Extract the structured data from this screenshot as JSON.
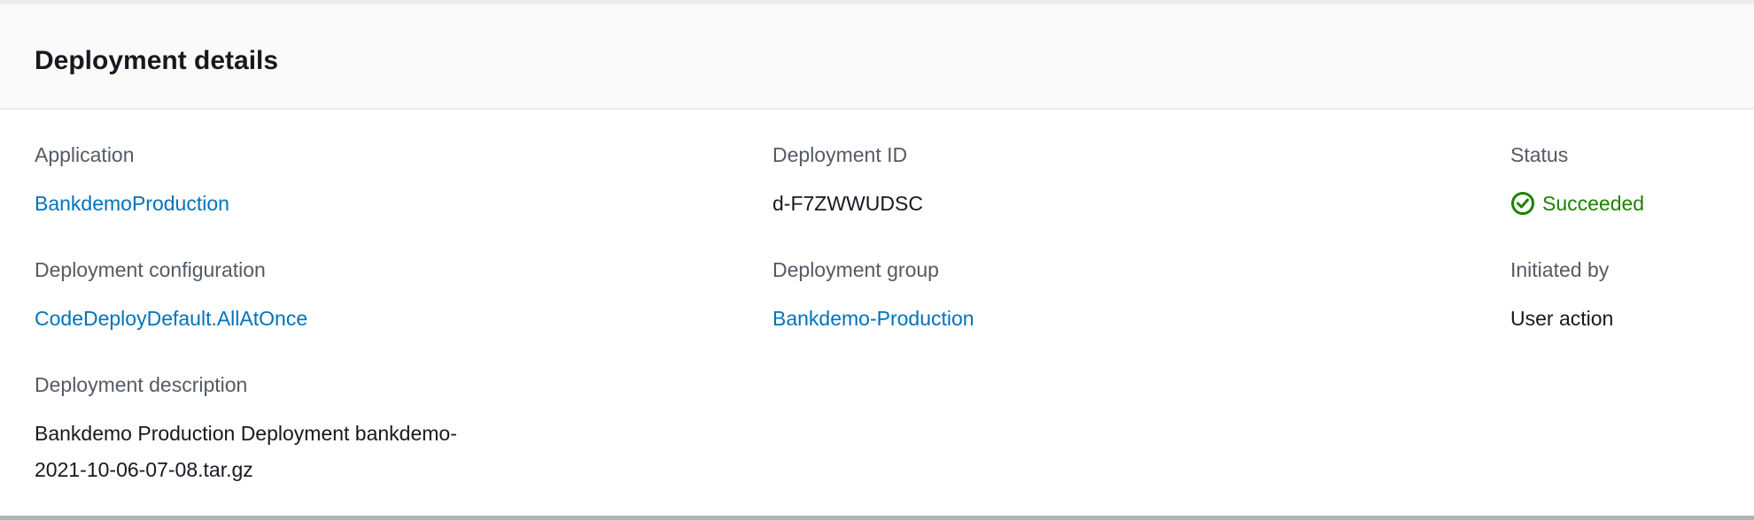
{
  "header": {
    "title": "Deployment details"
  },
  "fields": {
    "application": {
      "label": "Application",
      "value": "BankdemoProduction"
    },
    "deployment_id": {
      "label": "Deployment ID",
      "value": "d-F7ZWWUDSC"
    },
    "status": {
      "label": "Status",
      "value": "Succeeded",
      "icon": "check-circle-icon",
      "color": "#1d8102"
    },
    "deployment_configuration": {
      "label": "Deployment configuration",
      "value": "CodeDeployDefault.AllAtOnce"
    },
    "deployment_group": {
      "label": "Deployment group",
      "value": "Bankdemo-Production"
    },
    "initiated_by": {
      "label": "Initiated by",
      "value": "User action"
    },
    "deployment_description": {
      "label": "Deployment description",
      "line1": "Bankdemo Production Deployment bankdemo-",
      "line2": "2021-10-06-07-08.tar.gz"
    }
  }
}
